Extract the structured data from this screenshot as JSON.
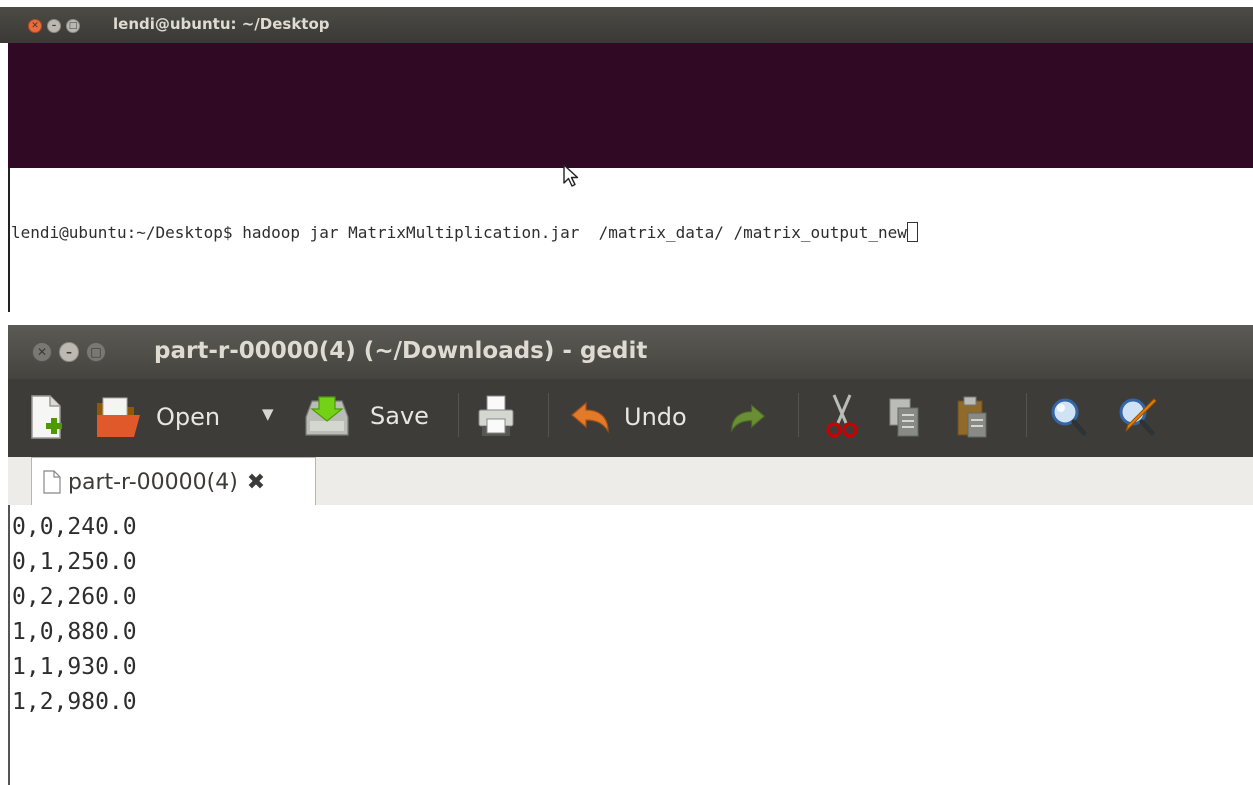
{
  "terminal": {
    "title": "lendi@ubuntu: ~/Desktop",
    "prompt": "lendi@ubuntu:~/Desktop$ ",
    "command": "hadoop jar MatrixMultiplication.jar  /matrix_data/ /matrix_output_new"
  },
  "gedit": {
    "title": "part-r-00000(4) (~/Downloads) - gedit",
    "toolbar": {
      "open_label": "Open",
      "save_label": "Save",
      "undo_label": "Undo"
    },
    "tab": {
      "label": "part-r-00000(4)"
    },
    "lines": [
      "0,0,240.0",
      "0,1,250.0",
      "0,2,260.0",
      "1,0,880.0",
      "1,1,930.0",
      "1,2,980.0"
    ]
  },
  "colors": {
    "terminal_bg": "#300a24",
    "titlebar": "#3c3b37",
    "close_orange": "#ea6b3c"
  }
}
